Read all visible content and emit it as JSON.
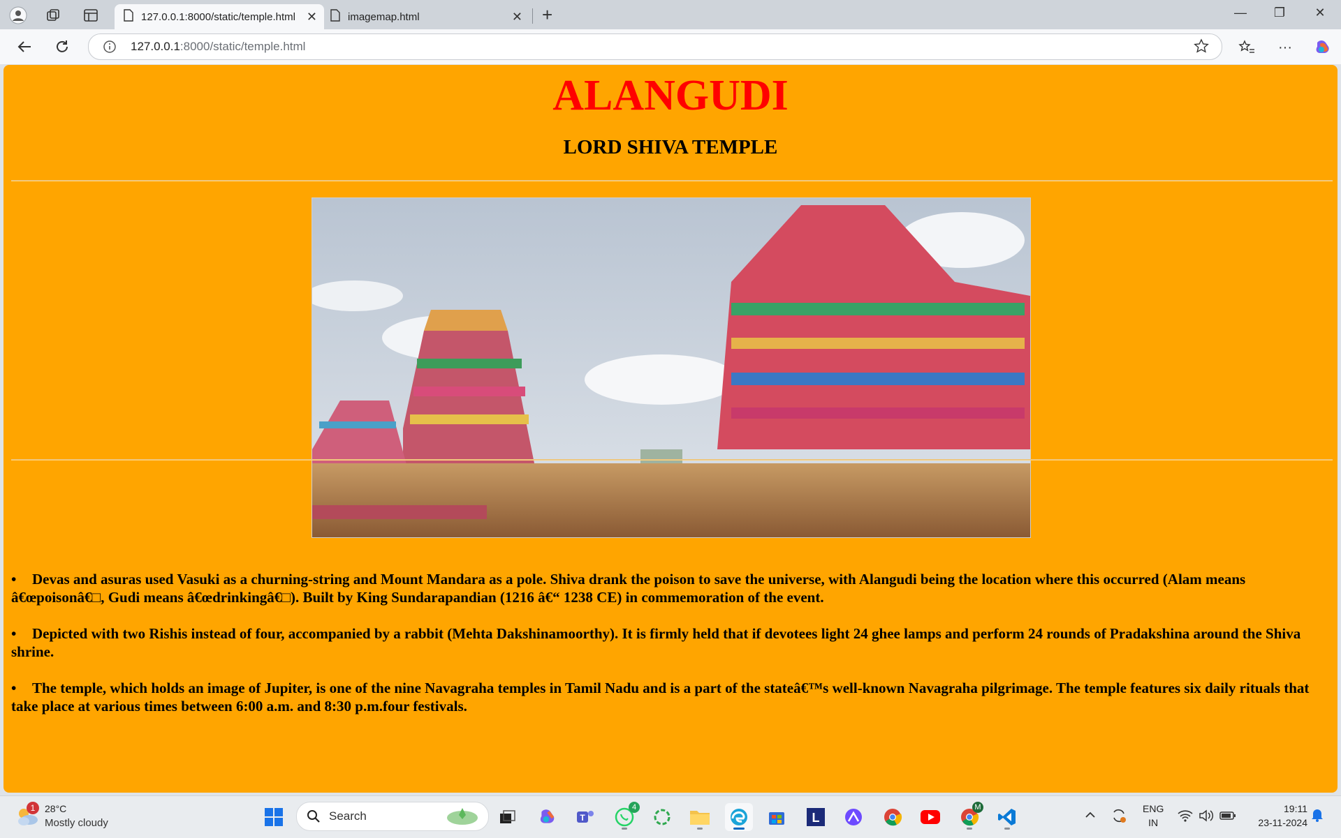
{
  "browser": {
    "tabs": [
      {
        "title": "127.0.0.1:8000/static/temple.html",
        "active": true
      },
      {
        "title": "imagemap.html",
        "active": false
      }
    ],
    "address": {
      "host": "127.0.0.1",
      "path": ":8000/static/temple.html"
    }
  },
  "page": {
    "title": "ALANGUDI",
    "subtitle": "LORD SHIVA TEMPLE",
    "image_alt": "Temple towers",
    "facts": [
      "Devas and asuras used Vasuki as a churning-string and Mount Mandara as a pole. Shiva drank the poison to save the universe, with Alangudi being the location where this occurred (Alam means â€œpoisonâ€□, Gudi means â€œdrinkingâ€□). Built by King Sundarapandian (1216 â€“ 1238 CE) in commemoration of the event.",
      "Depicted with two Rishis instead of four, accompanied by a rabbit (Mehta Dakshinamoorthy). It is firmly held that if devotees light 24 ghee lamps and perform 24 rounds of Pradakshina around the Shiva shrine.",
      "The temple, which holds an image of Jupiter, is one of the nine Navagraha temples in Tamil Nadu and is a part of the stateâ€™s well-known Navagraha pilgrimage. The temple features six daily rituals that take place at various times between 6:00 a.m. and 8:30 p.m.four festivals."
    ],
    "bullet": "•"
  },
  "taskbar": {
    "weather": {
      "temp": "28°C",
      "desc": "Mostly cloudy",
      "badge": "1"
    },
    "search_placeholder": "Search",
    "whatsapp_badge": "4",
    "chrome_profile_badge": "M",
    "language": {
      "line1": "ENG",
      "line2": "IN"
    },
    "clock": {
      "time": "19:11",
      "date": "23-11-2024"
    }
  },
  "colors": {
    "page_bg": "#ffa500",
    "title": "#ff0000",
    "accent": "#0067c0"
  }
}
